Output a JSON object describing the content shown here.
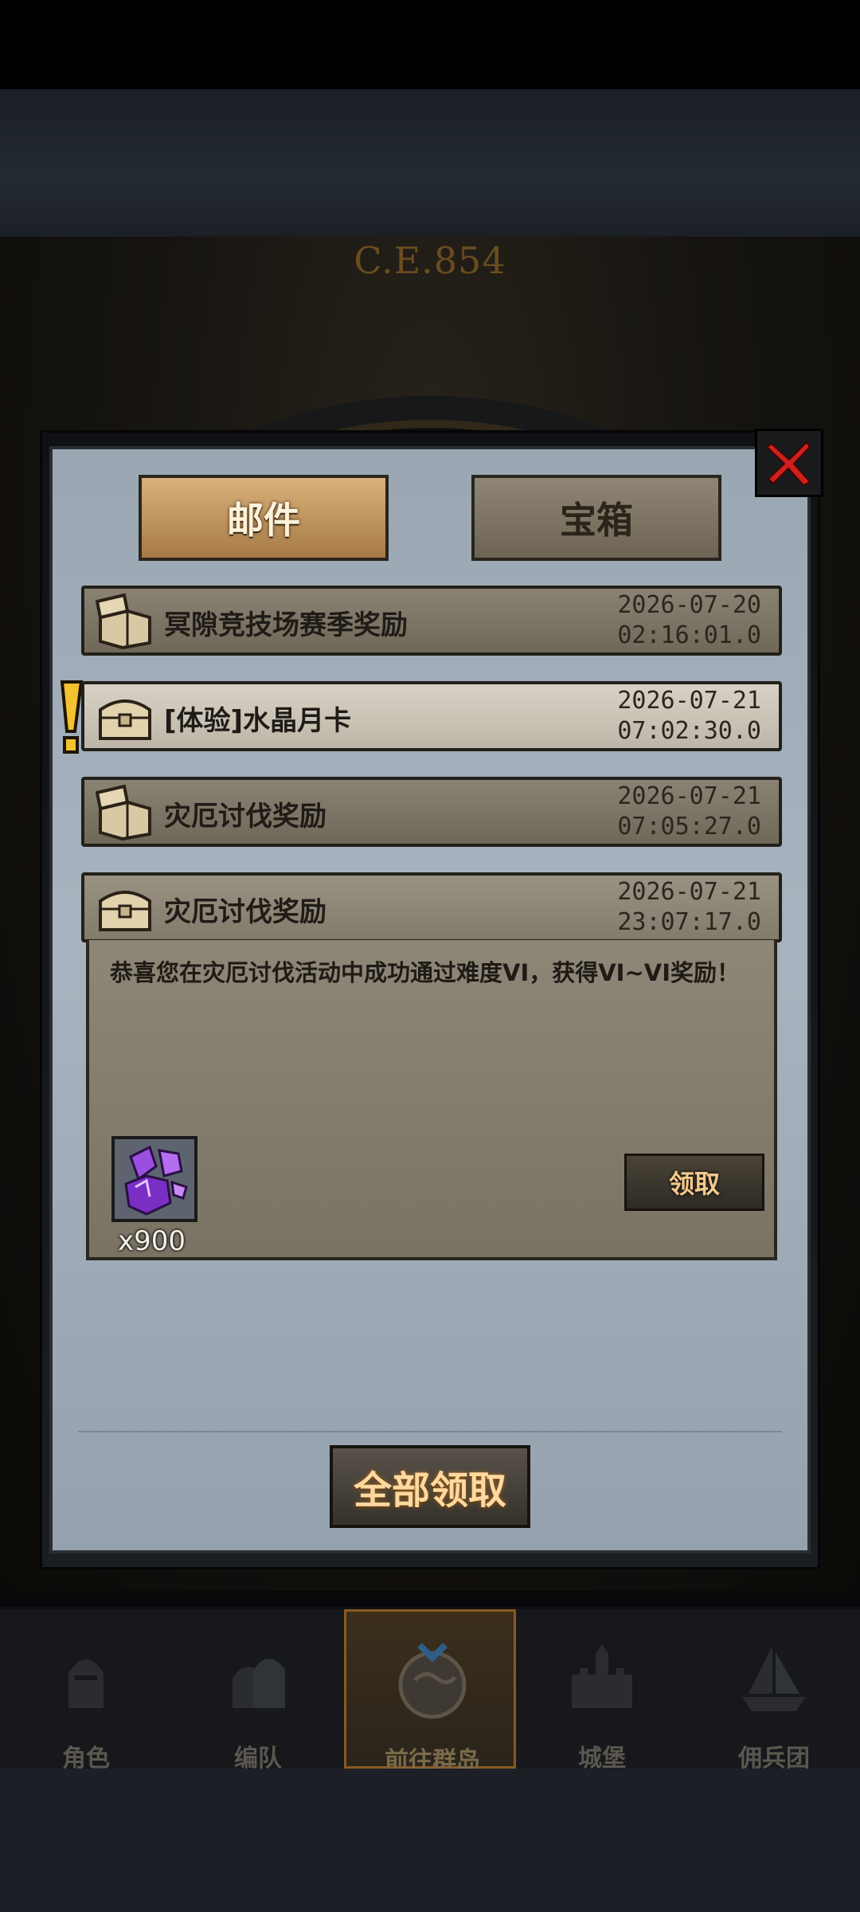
{
  "header": {
    "era_label": "C.E.854"
  },
  "dialog": {
    "tabs": [
      {
        "label": "邮件",
        "active": true
      },
      {
        "label": "宝箱",
        "active": false
      }
    ],
    "mails": [
      {
        "title": "冥隙竞技场赛季奖励",
        "date": "2026-07-20",
        "time": "02:16:01.0",
        "state": "read"
      },
      {
        "title": "[体验]水晶月卡",
        "date": "2026-07-21",
        "time": "07:02:30.0",
        "state": "unread"
      },
      {
        "title": "灾厄讨伐奖励",
        "date": "2026-07-21",
        "time": "07:05:27.0",
        "state": "read"
      },
      {
        "title": "灾厄讨伐奖励",
        "date": "2026-07-21",
        "time": "23:07:17.0",
        "state": "open"
      }
    ],
    "open_mail": {
      "body": "恭喜您在灾厄讨伐活动中成功通过难度VI，获得VI~VI奖励！",
      "reward": {
        "icon": "purple-crystal-icon",
        "count": "x900"
      },
      "claim_label": "领取"
    },
    "claim_all_label": "全部领取"
  },
  "bottom_nav": [
    {
      "label": "角色",
      "icon": "knight-helmet-icon"
    },
    {
      "label": "编队",
      "icon": "team-helmet-icon"
    },
    {
      "label": "前往群岛",
      "icon": "compass-globe-icon",
      "active": true
    },
    {
      "label": "城堡",
      "icon": "castle-icon"
    },
    {
      "label": "佣兵团",
      "icon": "ship-icon"
    }
  ],
  "colors": {
    "dialog_bg": "#a7b3be",
    "active_tab": "#d9b17b",
    "claim_text": "#ffd9a0",
    "close_red": "#d0201c"
  }
}
